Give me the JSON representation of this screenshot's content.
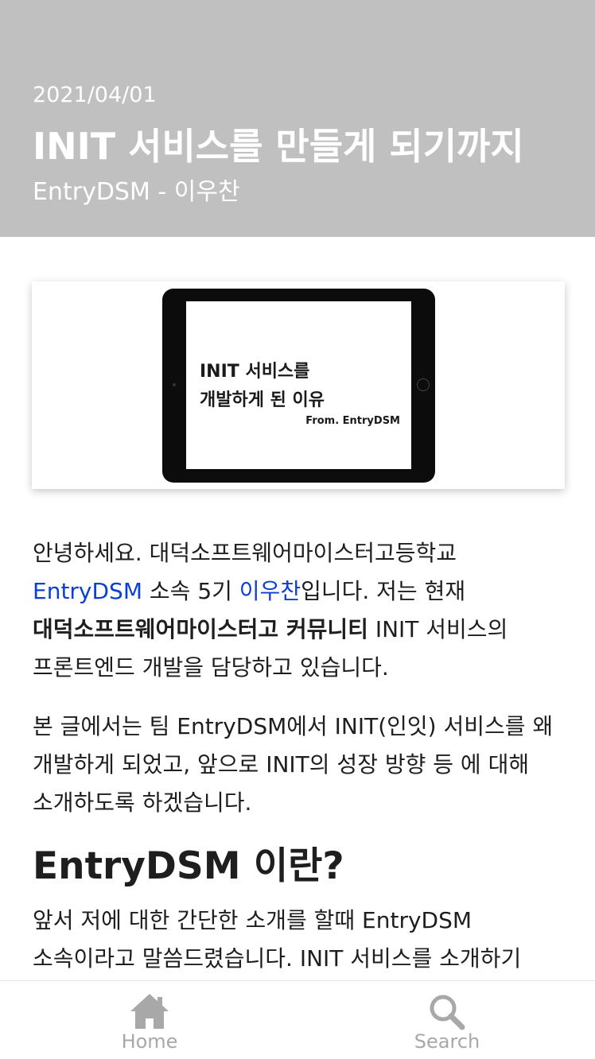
{
  "header": {
    "date": "2021/04/01",
    "title": "INIT 서비스를 만들게 되기까지",
    "author": "EntryDSM - 이우찬",
    "background": "#c0c0c0"
  },
  "hero": {
    "line1": "INIT 서비스를",
    "line2": "개발하게 된 이유",
    "from": "From. EntryDSM"
  },
  "article": {
    "p1": {
      "t1": "안녕하세요. 대덕소프트웨어마이스터고등학교 ",
      "link1": "EntryDSM",
      "t2": " 소속 5기 ",
      "link2": "이우찬",
      "t3": "입니다. 저는 현재 ",
      "bold": "대덕소프트웨어마이스터고 커뮤니티",
      "t4": " INIT 서비스의 프론트엔드 개발을 담당하고 있습니다."
    },
    "p2": "본 글에서는 팀 EntryDSM에서 INIT(인잇) 서비스를 왜 개발하게 되었고, 앞으로 INIT의 성장 방향 등 에 대해 소개하도록 하겠습니다.",
    "h2": "EntryDSM 이란?",
    "p3": "앞서 저에 대한 간단한 소개를 할때 EntryDSM 소속이라고 말씀드렸습니다. INIT 서비스를 소개하기",
    "link_color": "#0b3fd6"
  },
  "tabbar": {
    "home_label": "Home",
    "home_icon": "home-icon",
    "search_label": "Search",
    "search_icon": "search-icon",
    "inactive_color": "#a8a8a8"
  }
}
